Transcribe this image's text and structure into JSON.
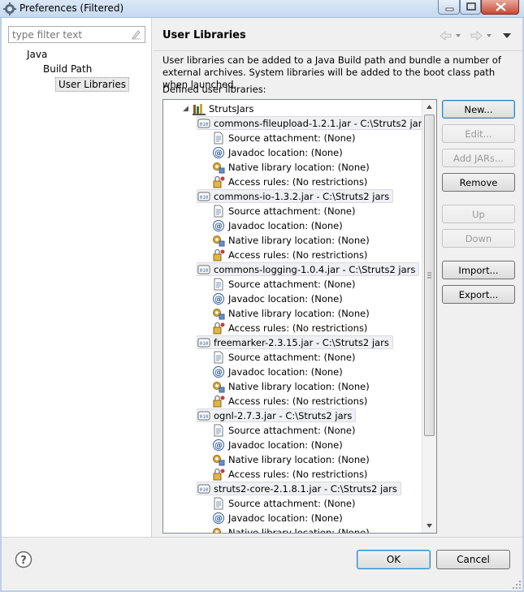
{
  "window": {
    "title": "Preferences (Filtered)"
  },
  "filter": {
    "placeholder": "type filter text"
  },
  "nav": {
    "items": [
      "Java",
      "Build Path",
      "User Libraries"
    ]
  },
  "page": {
    "title": "User Libraries",
    "description": "User libraries can be added to a Java Build path and bundle a number of external archives. System libraries will be added to the boot class path when launched.",
    "defined_label": "Defined user libraries:"
  },
  "tree": {
    "library": "StrutsJars",
    "jars": [
      {
        "label": "commons-fileupload-1.2.1.jar - C:\\Struts2 jars"
      },
      {
        "label": "commons-io-1.3.2.jar - C:\\Struts2 jars"
      },
      {
        "label": "commons-logging-1.0.4.jar - C:\\Struts2 jars"
      },
      {
        "label": "freemarker-2.3.15.jar - C:\\Struts2 jars"
      },
      {
        "label": "ognl-2.7.3.jar - C:\\Struts2 jars"
      },
      {
        "label": "struts2-core-2.1.8.1.jar - C:\\Struts2 jars"
      }
    ],
    "attrs": {
      "source": "Source attachment: (None)",
      "javadoc": "Javadoc location: (None)",
      "native": "Native library location: (None)",
      "access": "Access rules: (No restrictions)"
    }
  },
  "buttons": {
    "new": "New...",
    "edit": "Edit...",
    "add_jars": "Add JARs...",
    "remove": "Remove",
    "up": "Up",
    "down": "Down",
    "import": "Import...",
    "export": "Export...",
    "ok": "OK",
    "cancel": "Cancel"
  },
  "icons": {
    "app": "preferences-gear-icon",
    "library": "library-icon",
    "jar": "jar-icon",
    "source": "source-attachment-icon",
    "javadoc": "javadoc-icon",
    "native": "native-library-icon",
    "access": "access-rules-icon",
    "help": "help-icon"
  },
  "colors": {
    "accent": "#3c7fb1",
    "selection": "#e9e9e9"
  }
}
